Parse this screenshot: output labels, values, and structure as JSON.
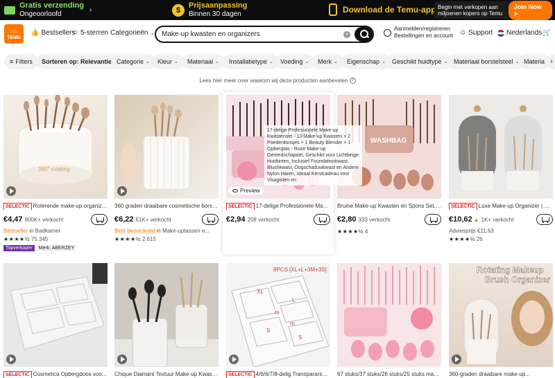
{
  "promo": {
    "free_shipping": "Gratis verzending",
    "free_shipping_sub": "Ongeoorloofd",
    "price_adjust": "Prijsaanpassing",
    "price_adjust_sub": "Binnen 30 dagen",
    "download": "Download de Temu-app",
    "sell_text": "Begin met verkopen aan miljoenen kopers op Temu",
    "join": "Join Now",
    "join_arrow": ">"
  },
  "header": {
    "logo": "TEMU",
    "bestsellers": "Bestsellers",
    "five_star": "5-sterren",
    "categories": "Categorieën",
    "search_value": "Make-up kwasten en organizers",
    "account_line1": "Aanmelden/registreren",
    "account_line2": "Bestellingen en account",
    "support": "Support",
    "language": "Nederlands"
  },
  "filters": [
    "Filters",
    "Sorteren op: Relevantie",
    "Categorie",
    "Kleur",
    "Materiaal",
    "Installatietype",
    "Voeding",
    "Merk",
    "Eigenschap",
    "Geschikt huidtype",
    "Materiaal borstelsteel",
    "Materia"
  ],
  "info_line": "Lees hier meer over waarom wij deze producten aanbevelen",
  "products": [
    {
      "badge": "SELECTIC",
      "title": "Roterende make-up organizer |...",
      "price": "€4,47",
      "sold": "900K+ verkocht",
      "meta_a": "Bestseller",
      "meta_b": " in Badkamer",
      "stars": "★★★★½",
      "reviews": "75.345",
      "tag1": "Topverkoper",
      "tag2": "Merk: ABERZEY"
    },
    {
      "badge": "",
      "title": "360 graden draaibare cosmetische borstel...",
      "price": "€6,22",
      "sold": "61K+ verkocht",
      "meta_a": "Best beoordeeld",
      "meta_b": " in Make-uptassen e...",
      "stars": "★★★★½",
      "reviews": "2.615"
    },
    {
      "badge": "SELECTIC",
      "title": "17-delige Professionele Make-u...",
      "price": "€2,94",
      "sold": "208 verkocht",
      "preview": "Preview"
    },
    {
      "badge": "",
      "title": "Bruine Make-up Kwasten en Spons Set, Pro...",
      "price": "€2,80",
      "sold": "333 verkocht",
      "stars": "★★★★½",
      "reviews": "4"
    },
    {
      "badge": "SELECTIC",
      "title": "Luxe Make-up Organizer | Verti...",
      "price": "€10,62",
      "sold": "1K+ verkocht",
      "meta_b": "Adviesprijs €11,63",
      "stars": "★★★★½",
      "reviews": "26"
    },
    {
      "badge": "SELECTIC",
      "title": "Cosmetica Opbergdoos voor..."
    },
    {
      "badge": "",
      "title": "Chique Diamant Textuur Make-up Kwasten..."
    },
    {
      "badge": "SELECTIC",
      "title": "4/6/6/7/8-delig Transparante A..."
    },
    {
      "badge": "",
      "title": "67 stuks/37 stuks/26 stuks/25 stuks make..."
    },
    {
      "badge": "",
      "title": "360-graden draaibare make-up..."
    }
  ],
  "tooltip": "17-delige Professionele Make-up Kwastenset - 13 Make-up Kwasten + 2 Poederdonsjes + 1 Beauty Blender + 1 Opbergtas - Roze Make-up Gereedschapset, Geschikt voor Lichtbeige Huidtinten, Inclusief Foundationkwast, Blushkwast, Oogschaduwkwast en Andere Nylon Haren, Ideaal Kerstcadeau voor Visagisten en",
  "image_texts": {
    "rotating": "360° rotating",
    "washbag": "WASHBAG",
    "pcs": "8PCS [XL+L+3M+3S]",
    "xl": "XL",
    "l": "L",
    "m": "m",
    "s": "S",
    "rotating_title": "Rotating Makeup Brush Organizer"
  }
}
